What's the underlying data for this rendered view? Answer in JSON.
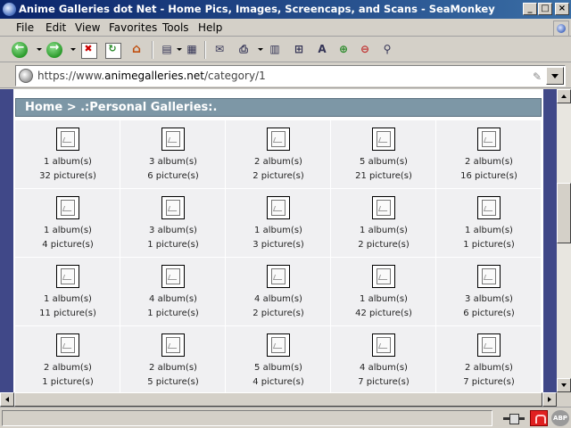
{
  "window": {
    "title": "Anime Galleries dot Net - Home Pics, Images, Screencaps, and Scans - SeaMonkey",
    "buttons": {
      "minimize": "_",
      "maximize": "□",
      "close": "×"
    }
  },
  "menu": {
    "items": [
      "File",
      "Edit",
      "View",
      "Favorites",
      "Tools",
      "Help"
    ]
  },
  "toolbar": {
    "icons": [
      "back-icon",
      "forward-icon",
      "stop-icon",
      "reload-icon",
      "home-icon",
      "bookmarks-icon",
      "history-icon",
      "mail-icon",
      "print-icon",
      "tabs-icon",
      "sitemap-icon",
      "text-size-icon",
      "zoom-in-icon",
      "zoom-out-icon",
      "search-icon"
    ]
  },
  "address": {
    "scheme": "https://www.",
    "domain": "animegalleries.net",
    "path": "/category/1"
  },
  "breadcrumb": "Home > .:Personal Galleries:.",
  "galleries": [
    [
      {
        "albums": "1 album(s)",
        "pictures": "32 picture(s)"
      },
      {
        "albums": "3 album(s)",
        "pictures": "6 picture(s)"
      },
      {
        "albums": "2 album(s)",
        "pictures": "2 picture(s)"
      },
      {
        "albums": "5 album(s)",
        "pictures": "21 picture(s)"
      },
      {
        "albums": "2 album(s)",
        "pictures": "16 picture(s)"
      }
    ],
    [
      {
        "albums": "1 album(s)",
        "pictures": "4 picture(s)"
      },
      {
        "albums": "3 album(s)",
        "pictures": "1 picture(s)"
      },
      {
        "albums": "1 album(s)",
        "pictures": "3 picture(s)"
      },
      {
        "albums": "1 album(s)",
        "pictures": "2 picture(s)"
      },
      {
        "albums": "1 album(s)",
        "pictures": "1 picture(s)"
      }
    ],
    [
      {
        "albums": "1 album(s)",
        "pictures": "11 picture(s)"
      },
      {
        "albums": "4 album(s)",
        "pictures": "1 picture(s)"
      },
      {
        "albums": "4 album(s)",
        "pictures": "2 picture(s)"
      },
      {
        "albums": "1 album(s)",
        "pictures": "42 picture(s)"
      },
      {
        "albums": "3 album(s)",
        "pictures": "6 picture(s)"
      }
    ],
    [
      {
        "albums": "2 album(s)",
        "pictures": "1 picture(s)"
      },
      {
        "albums": "2 album(s)",
        "pictures": "5 picture(s)"
      },
      {
        "albums": "5 album(s)",
        "pictures": "4 picture(s)"
      },
      {
        "albums": "4 album(s)",
        "pictures": "7 picture(s)"
      },
      {
        "albums": "2 album(s)",
        "pictures": "7 picture(s)"
      }
    ]
  ],
  "status": {
    "text": "",
    "abp_label": "ABP"
  },
  "colors": {
    "page_background": "#404888",
    "breadcrumb_bar": "#7d97a6",
    "cell_background": "#f0f0f2"
  }
}
